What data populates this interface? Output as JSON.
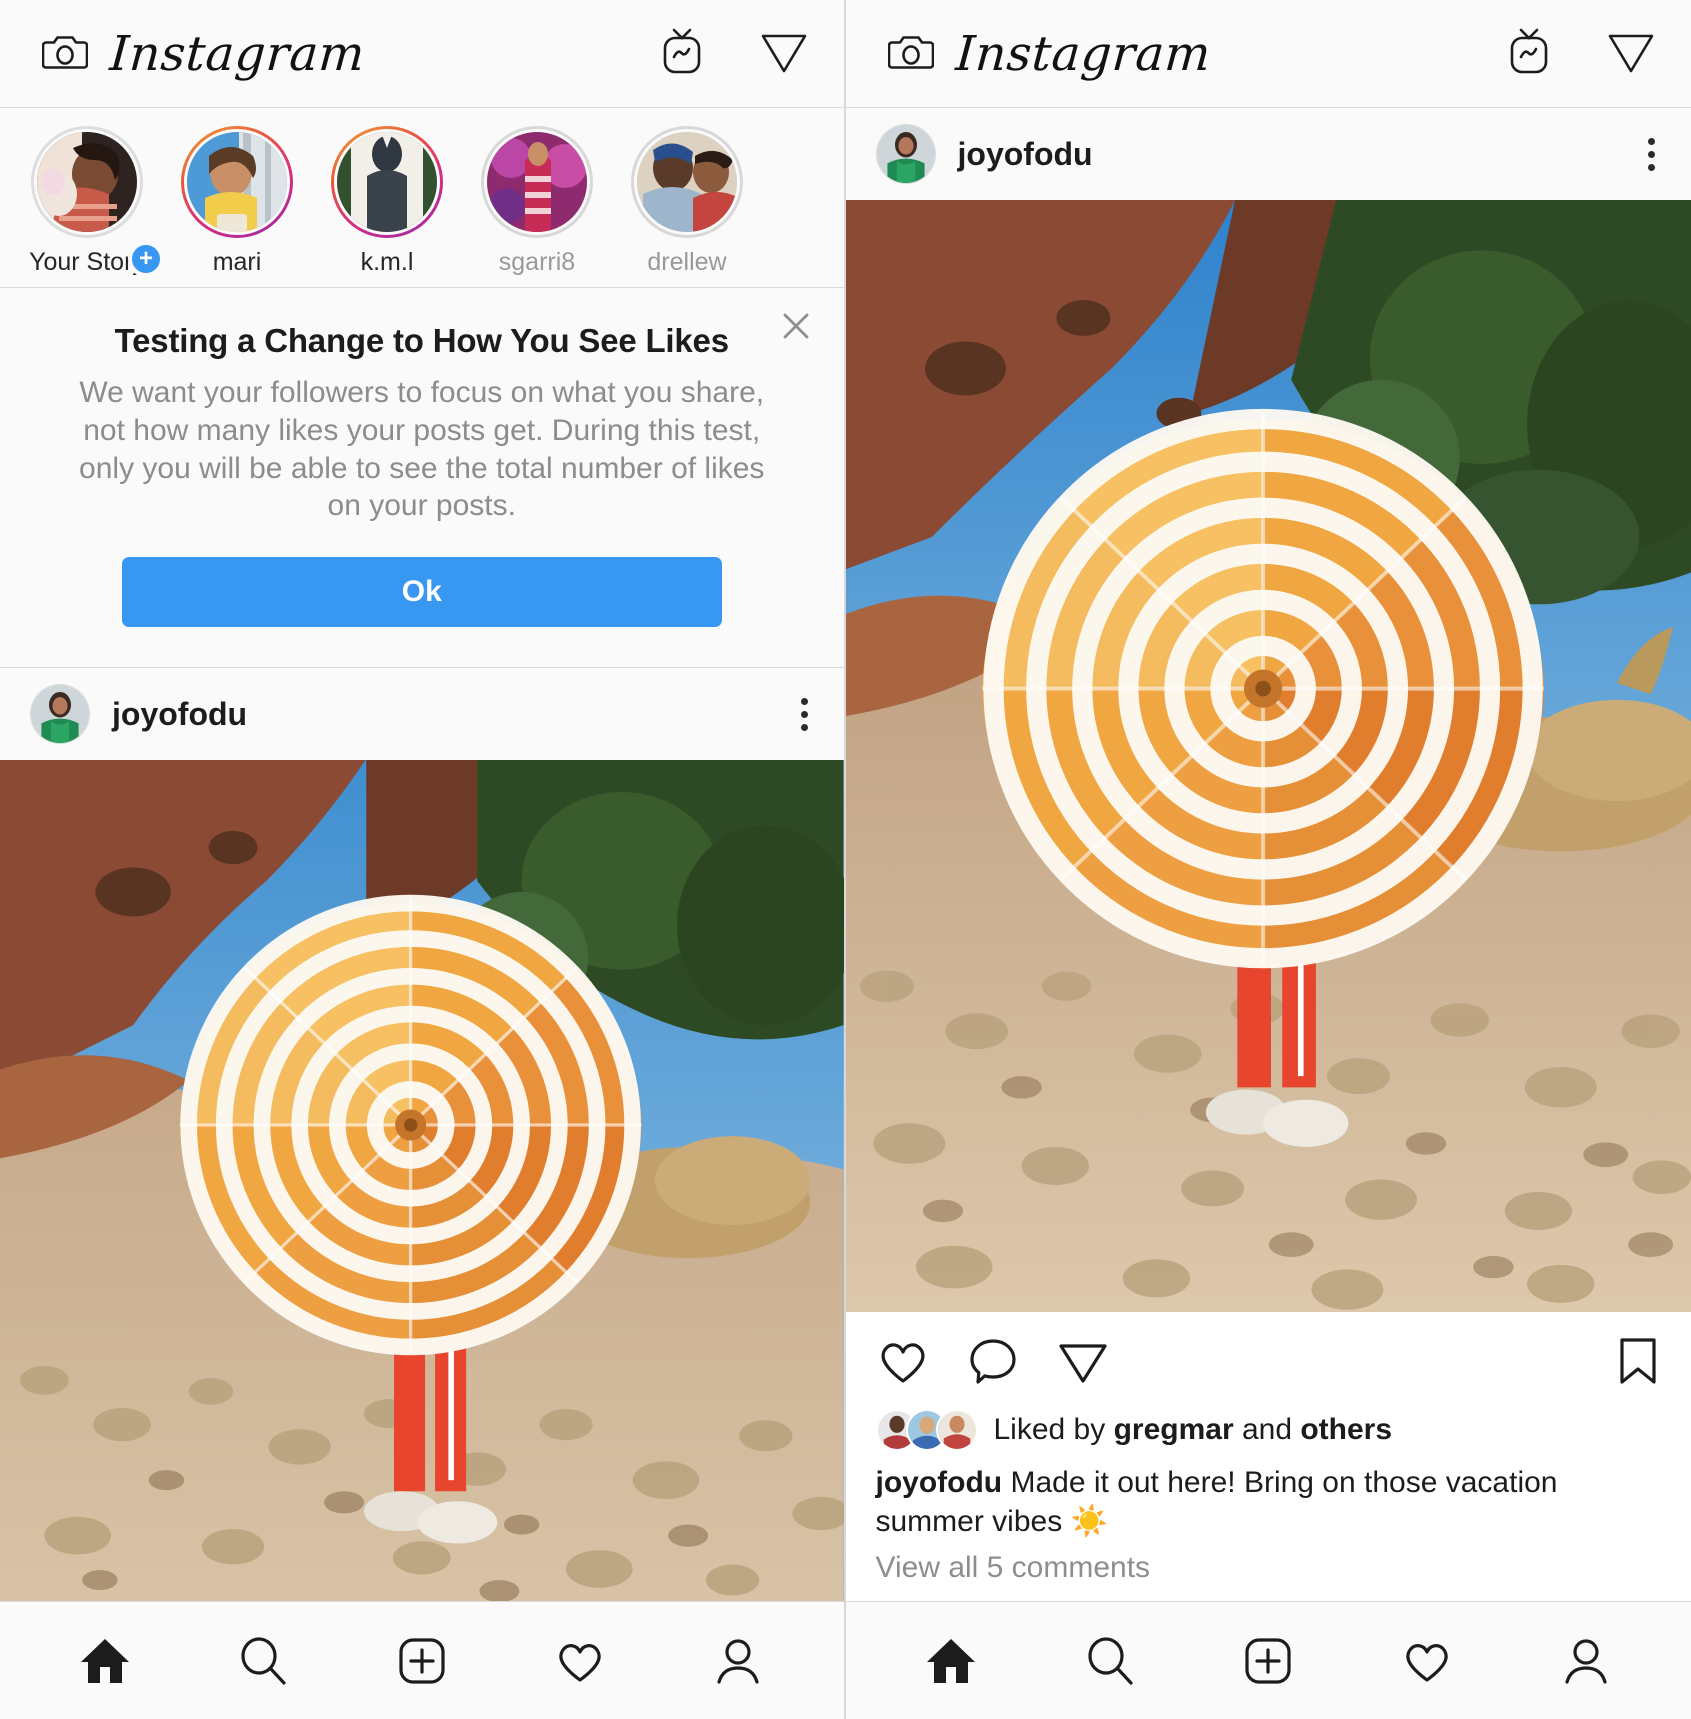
{
  "app": {
    "name": "Instagram",
    "brand_wordmark": "Instagram",
    "accent_blue": "#3897f0",
    "text_primary": "#262626",
    "text_muted": "#8e8e8e",
    "background": "#fafafa"
  },
  "topbar": {
    "camera_icon": "camera-icon",
    "title": "Instagram",
    "igtv_icon": "igtv-icon",
    "direct_icon": "direct-message-icon"
  },
  "stories": [
    {
      "label": "Your Story",
      "ring": "none",
      "has_add_badge": true,
      "muted": false
    },
    {
      "label": "mari",
      "ring": "gradient",
      "has_add_badge": false,
      "muted": false
    },
    {
      "label": "k.m.l",
      "ring": "gradient",
      "has_add_badge": false,
      "muted": false
    },
    {
      "label": "sgarri8",
      "ring": "seen",
      "has_add_badge": false,
      "muted": true
    },
    {
      "label": "drellew",
      "ring": "seen",
      "has_add_badge": false,
      "muted": true
    }
  ],
  "notice": {
    "title": "Testing a Change to How You See Likes",
    "body": "We want your followers to focus on what you share, not how many likes your posts get. During this test, only you will be able to see the total number of likes on your posts.",
    "ok_label": "Ok",
    "close_icon": "close-icon"
  },
  "post": {
    "username": "joyofodu",
    "avatar": "joyofodu-avatar",
    "more_icon": "more-options-icon",
    "photo_alt": "person holding orange and white striped beach umbrella on rocky ground",
    "actions": {
      "like_icon": "heart-icon",
      "comment_icon": "comment-icon",
      "share_icon": "share-icon",
      "save_icon": "bookmark-icon"
    },
    "likes_prefix": "Liked by ",
    "likes_user": "gregmar",
    "likes_suffix": " and ",
    "likes_others": "others",
    "caption_author": "joyofodu",
    "caption_text": " Made it out here! Bring on those vacation summer vibes ☀️",
    "comments_label": "View all 5 comments"
  },
  "bottomnav": [
    {
      "name": "home-icon",
      "label": "Home",
      "active": true
    },
    {
      "name": "search-icon",
      "label": "Search",
      "active": false
    },
    {
      "name": "add-post-icon",
      "label": "New Post",
      "active": false
    },
    {
      "name": "activity-heart-icon",
      "label": "Activity",
      "active": false
    },
    {
      "name": "profile-icon",
      "label": "Profile",
      "active": false
    }
  ]
}
